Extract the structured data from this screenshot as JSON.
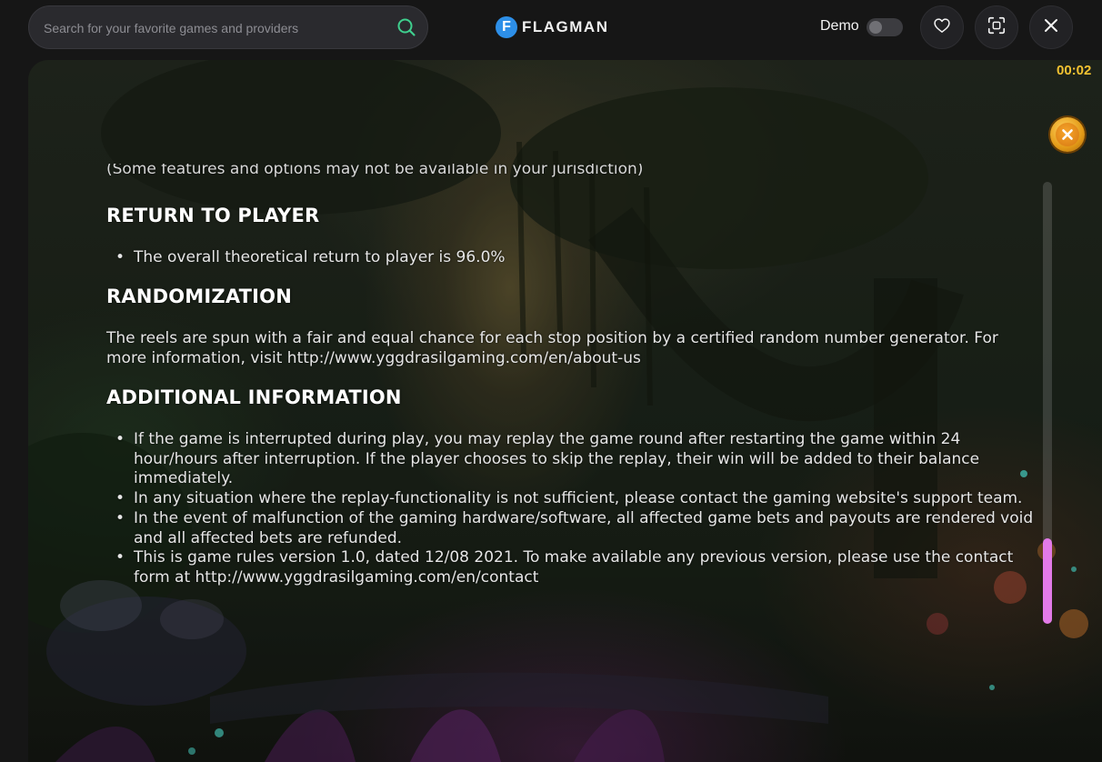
{
  "search": {
    "placeholder": "Search for your favorite games and providers"
  },
  "brand": {
    "logo_letter": "F",
    "name": "FLAGMAN"
  },
  "header": {
    "demo_label": "Demo",
    "demo_enabled": false
  },
  "game": {
    "timer": "00:02"
  },
  "rules": {
    "cut_line": "(Some features and options may not be available in your jurisdiction)",
    "rtp_heading": "RETURN TO PLAYER",
    "rtp_items": [
      "The overall theoretical return to player is 96.0%"
    ],
    "randomization_heading": "RANDOMIZATION",
    "randomization_text": "The reels are spun with a fair and equal chance for each stop position by a certified random number generator. For more information, visit http://www.yggdrasilgaming.com/en/about-us",
    "additional_heading": "ADDITIONAL INFORMATION",
    "additional_items": [
      "If the game is interrupted during play, you may replay the game round after restarting the game within 24 hour/hours after interruption. If the player chooses to skip the replay, their win will be added to their balance immediately.",
      "In any situation where the replay-functionality is not sufficient, please contact the gaming website's support team.",
      "In the event of malfunction of the gaming hardware/software, all affected game bets and payouts are rendered void and all affected bets are refunded.",
      "This is game rules version 1.0, dated 12/08 2021. To make available any previous version, please use the contact form at http://www.yggdrasilgaming.com/en/contact"
    ]
  },
  "colors": {
    "accent_scrollbar": "#e27ae8",
    "timer": "#f2c231",
    "logo_blue": "#2d8fe8",
    "search_icon": "#3fcf8e"
  },
  "icons": {
    "search": "search-icon",
    "favorite": "heart-icon",
    "fullscreen": "fullscreen-icon",
    "close": "close-icon",
    "close_rules": "close-rules-icon"
  }
}
